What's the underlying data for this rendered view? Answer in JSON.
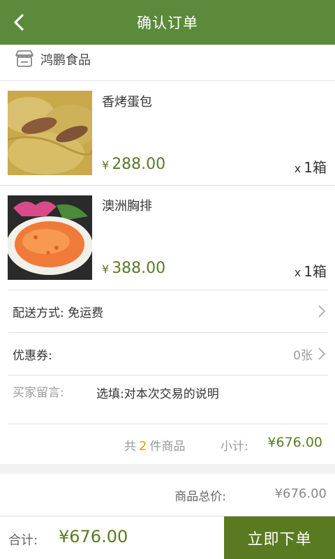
{
  "header": {
    "title": "确认订单"
  },
  "shop": {
    "name": "鸿鹏食品"
  },
  "items": [
    {
      "name": "香烤蛋包",
      "currency": "¥",
      "price": "288.00",
      "qty_prefix": "x",
      "qty": "1箱"
    },
    {
      "name": "澳洲胸排",
      "currency": "¥",
      "price": "388.00",
      "qty_prefix": "x",
      "qty": "1箱"
    }
  ],
  "delivery": {
    "label": "配送方式:",
    "value": "免运费"
  },
  "coupon": {
    "label": "优惠券:",
    "value": "0张"
  },
  "message": {
    "label": "买家留言:",
    "placeholder": "选填:对本次交易的说明"
  },
  "summary": {
    "count_prefix": "共",
    "count": "2",
    "count_suffix": "件商品",
    "subtotal_label": "小计:",
    "subtotal": "¥676.00"
  },
  "totals": {
    "goods_label": "商品总价:",
    "goods_value": "¥676.00"
  },
  "footer": {
    "total_label": "合计:",
    "total_value": "¥676.00",
    "submit_label": "立即下单"
  },
  "colors": {
    "header_bg": "#5a8a3a",
    "accent": "#5a7a22",
    "count_highlight": "#e0a100"
  }
}
